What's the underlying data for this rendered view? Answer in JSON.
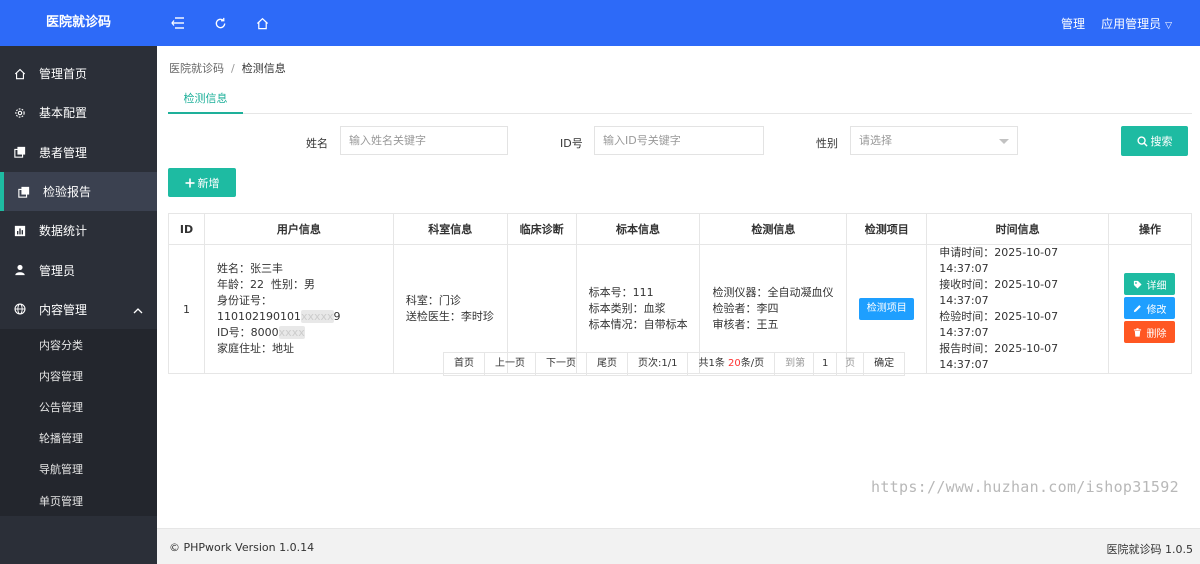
{
  "header": {
    "logo": "医院就诊码",
    "right_link": "管理",
    "user": "应用管理员"
  },
  "sidebar": {
    "items": [
      {
        "label": "管理首页",
        "icon": "home-icon"
      },
      {
        "label": "基本配置",
        "icon": "gear-icon"
      },
      {
        "label": "患者管理",
        "icon": "copy-icon"
      },
      {
        "label": "检验报告",
        "icon": "copy-icon",
        "active": true
      },
      {
        "label": "数据统计",
        "icon": "chart-icon"
      },
      {
        "label": "管理员",
        "icon": "user-icon"
      },
      {
        "label": "内容管理",
        "icon": "globe-icon",
        "expanded": true
      }
    ],
    "sub_items": [
      "内容分类",
      "内容管理",
      "公告管理",
      "轮播管理",
      "导航管理",
      "单页管理"
    ]
  },
  "breadcrumb": {
    "root": "医院就诊码",
    "sep": "/",
    "current": "检测信息"
  },
  "tab": "检测信息",
  "filters": {
    "name_label": "姓名",
    "name_placeholder": "输入姓名关键字",
    "id_label": "ID号",
    "id_placeholder": "输入ID号关键字",
    "gender_label": "性别",
    "gender_placeholder": "请选择",
    "search_button": "搜索",
    "add_button": "新增"
  },
  "table": {
    "headers": [
      "ID",
      "用户信息",
      "科室信息",
      "临床诊断",
      "标本信息",
      "检测信息",
      "检测项目",
      "时间信息",
      "操作"
    ],
    "row": {
      "id": "1",
      "user": {
        "name": "姓名：张三丰",
        "age_gender": "年龄：22  性别：男",
        "id_card_prefix": "身份证号：110102190101",
        "id_card_masked": "xxxxx",
        "id_card_suffix": "9",
        "id_no_prefix": "ID号：8000",
        "id_no_masked": "xxxx",
        "address": "家庭住址：地址"
      },
      "dept": {
        "dept": "科室：门诊",
        "doctor": "送检医生：李时珍"
      },
      "diagnosis": "",
      "sample": {
        "no": "标本号：111",
        "type": "标本类别：血浆",
        "condition": "标本情况：自带标本"
      },
      "test": {
        "instrument": "检测仪器：全自动凝血仪",
        "tester": "检验者：李四",
        "reviewer": "审核者：王五"
      },
      "item_button": "检测项目",
      "times": {
        "apply": "申请时间：2025-10-07 14:37:07",
        "receive": "接收时间：2025-10-07 14:37:07",
        "test": "检验时间：2025-10-07 14:37:07",
        "report": "报告时间：2025-10-07 14:37:07"
      },
      "ops": {
        "detail": "详细",
        "edit": "修改",
        "delete": "删除"
      }
    }
  },
  "pager": {
    "first": "首页",
    "prev": "上一页",
    "next": "下一页",
    "last": "尾页",
    "page_info": "页次:1/1",
    "total_pre": "共1条 ",
    "per_page": "20",
    "total_post": "条/页",
    "goto": "到第",
    "page_value": "1",
    "page_unit": "页",
    "confirm": "确定"
  },
  "watermark": "https://www.huzhan.com/ishop31592",
  "footer": {
    "left": "© PHPwork Version 1.0.14",
    "right": "医院就诊码 1.0.5"
  },
  "colors": {
    "header": "#2d6af8",
    "sidebar": "#2b2f38",
    "accent": "#1ebba2",
    "blue_button": "#1e9fff",
    "danger": "#ff5722"
  }
}
